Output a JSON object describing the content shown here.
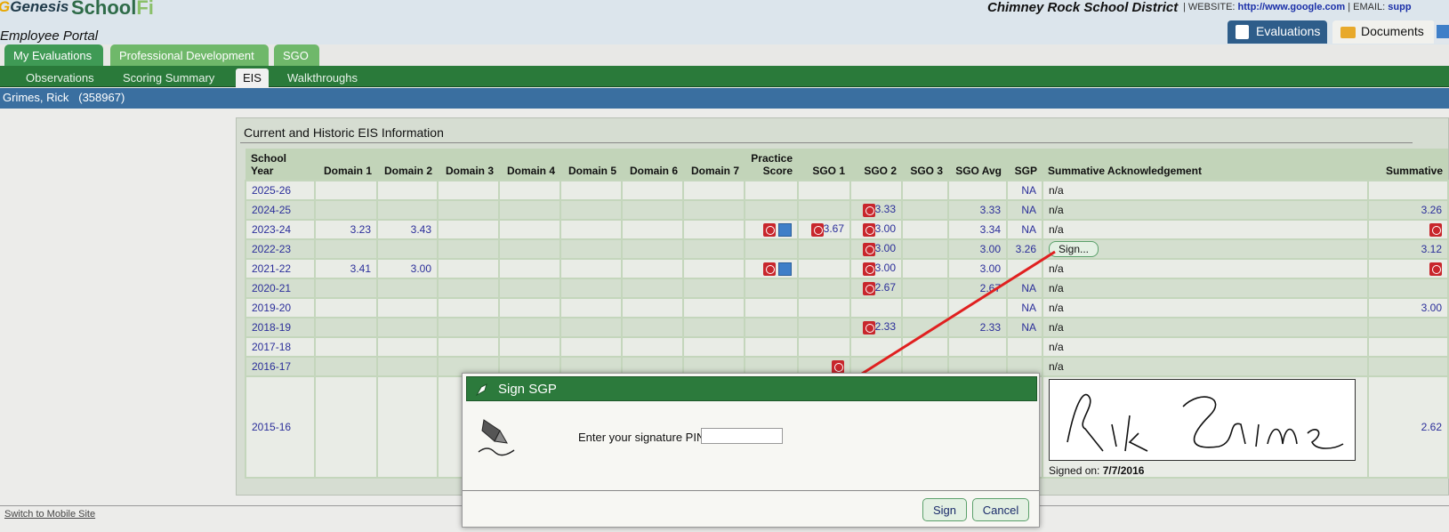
{
  "header": {
    "logo_genesis": "Genesis",
    "logo_schoolfi_school": "School",
    "logo_schoolfi_fi": "Fi",
    "portal": "Employee Portal",
    "district": "Chimney Rock School District",
    "website_label": "WEBSITE:",
    "website_url": "http://www.google.com",
    "email_label": "EMAIL:",
    "email_value": "supp",
    "buttons": {
      "evaluations": "Evaluations",
      "documents": "Documents"
    }
  },
  "tabs_primary": [
    "My Evaluations",
    "Professional Development",
    "SGO"
  ],
  "tabs_secondary": [
    "Observations",
    "Scoring Summary",
    "EIS",
    "Walkthroughs"
  ],
  "active_secondary_tab": "EIS",
  "user": {
    "name": "Grimes, Rick",
    "id": "(358967)"
  },
  "eis": {
    "title": "Current and Historic EIS Information",
    "columns": [
      "School Year",
      "Domain 1",
      "Domain 2",
      "Domain 3",
      "Domain 4",
      "Domain 5",
      "Domain 6",
      "Domain 7",
      "Practice Score",
      "SGO 1",
      "SGO 2",
      "SGO 3",
      "SGO Avg",
      "SGP",
      "Summative Acknowledgement",
      "Summative"
    ],
    "rows": [
      {
        "year": "2025-26",
        "d1": "",
        "d2": "",
        "practice": "",
        "sgo1": "",
        "sgo2": "",
        "sgoavg": "",
        "sgp": "NA",
        "ack": "n/a",
        "summative": ""
      },
      {
        "year": "2024-25",
        "d1": "",
        "d2": "",
        "practice": "",
        "sgo1": "",
        "sgo2": "3.33",
        "sgoavg": "3.33",
        "sgp": "NA",
        "ack": "n/a",
        "summative": "3.26"
      },
      {
        "year": "2023-24",
        "d1": "3.23",
        "d2": "3.43",
        "practice": "",
        "sgo1": "3.67",
        "sgo2": "3.00",
        "sgoavg": "3.34",
        "sgp": "NA",
        "ack": "n/a",
        "summative": ""
      },
      {
        "year": "2022-23",
        "d1": "",
        "d2": "",
        "practice": "",
        "sgo1": "",
        "sgo2": "3.00",
        "sgoavg": "3.00",
        "sgp": "3.26",
        "ack": "Sign...",
        "summative": "3.12"
      },
      {
        "year": "2021-22",
        "d1": "3.41",
        "d2": "3.00",
        "practice": "",
        "sgo1": "",
        "sgo2": "3.00",
        "sgoavg": "3.00",
        "sgp": "",
        "ack": "n/a",
        "summative": ""
      },
      {
        "year": "2020-21",
        "d1": "",
        "d2": "",
        "practice": "",
        "sgo1": "",
        "sgo2": "2.67",
        "sgoavg": "2.67",
        "sgp": "NA",
        "ack": "n/a",
        "summative": ""
      },
      {
        "year": "2019-20",
        "d1": "",
        "d2": "",
        "practice": "",
        "sgo1": "",
        "sgo2": "",
        "sgoavg": "",
        "sgp": "NA",
        "ack": "n/a",
        "summative": "3.00"
      },
      {
        "year": "2018-19",
        "d1": "",
        "d2": "",
        "practice": "",
        "sgo1": "",
        "sgo2": "2.33",
        "sgoavg": "2.33",
        "sgp": "NA",
        "ack": "n/a",
        "summative": ""
      },
      {
        "year": "2017-18",
        "d1": "",
        "d2": "",
        "practice": "",
        "sgo1": "",
        "sgo2": "",
        "sgoavg": "",
        "sgp": "",
        "ack": "n/a",
        "summative": ""
      },
      {
        "year": "2016-17",
        "d1": "",
        "d2": "",
        "practice": "",
        "sgo1": "",
        "sgo2": "",
        "sgoavg": "",
        "sgp": "",
        "ack": "n/a",
        "summative": ""
      },
      {
        "year": "2015-16",
        "d1": "",
        "d2": "",
        "practice": "",
        "sgo1": "",
        "sgo2": "",
        "sgoavg": "",
        "sgp": "",
        "ack": "",
        "summative": "2.62"
      }
    ],
    "signature_name": "Rick Grimes",
    "signed_on_label": "Signed on:",
    "signed_on_date": "7/7/2016"
  },
  "footer": {
    "mobile_link": "Switch to Mobile Site"
  },
  "dialog": {
    "title": "Sign SGP",
    "pin_label": "Enter your signature PIN:",
    "pin_value": "",
    "sign_button": "Sign",
    "cancel_button": "Cancel"
  },
  "colors": {
    "green_header": "#2c7a3c",
    "blue_bar": "#3a6fa0",
    "arrow": "#e02020"
  }
}
